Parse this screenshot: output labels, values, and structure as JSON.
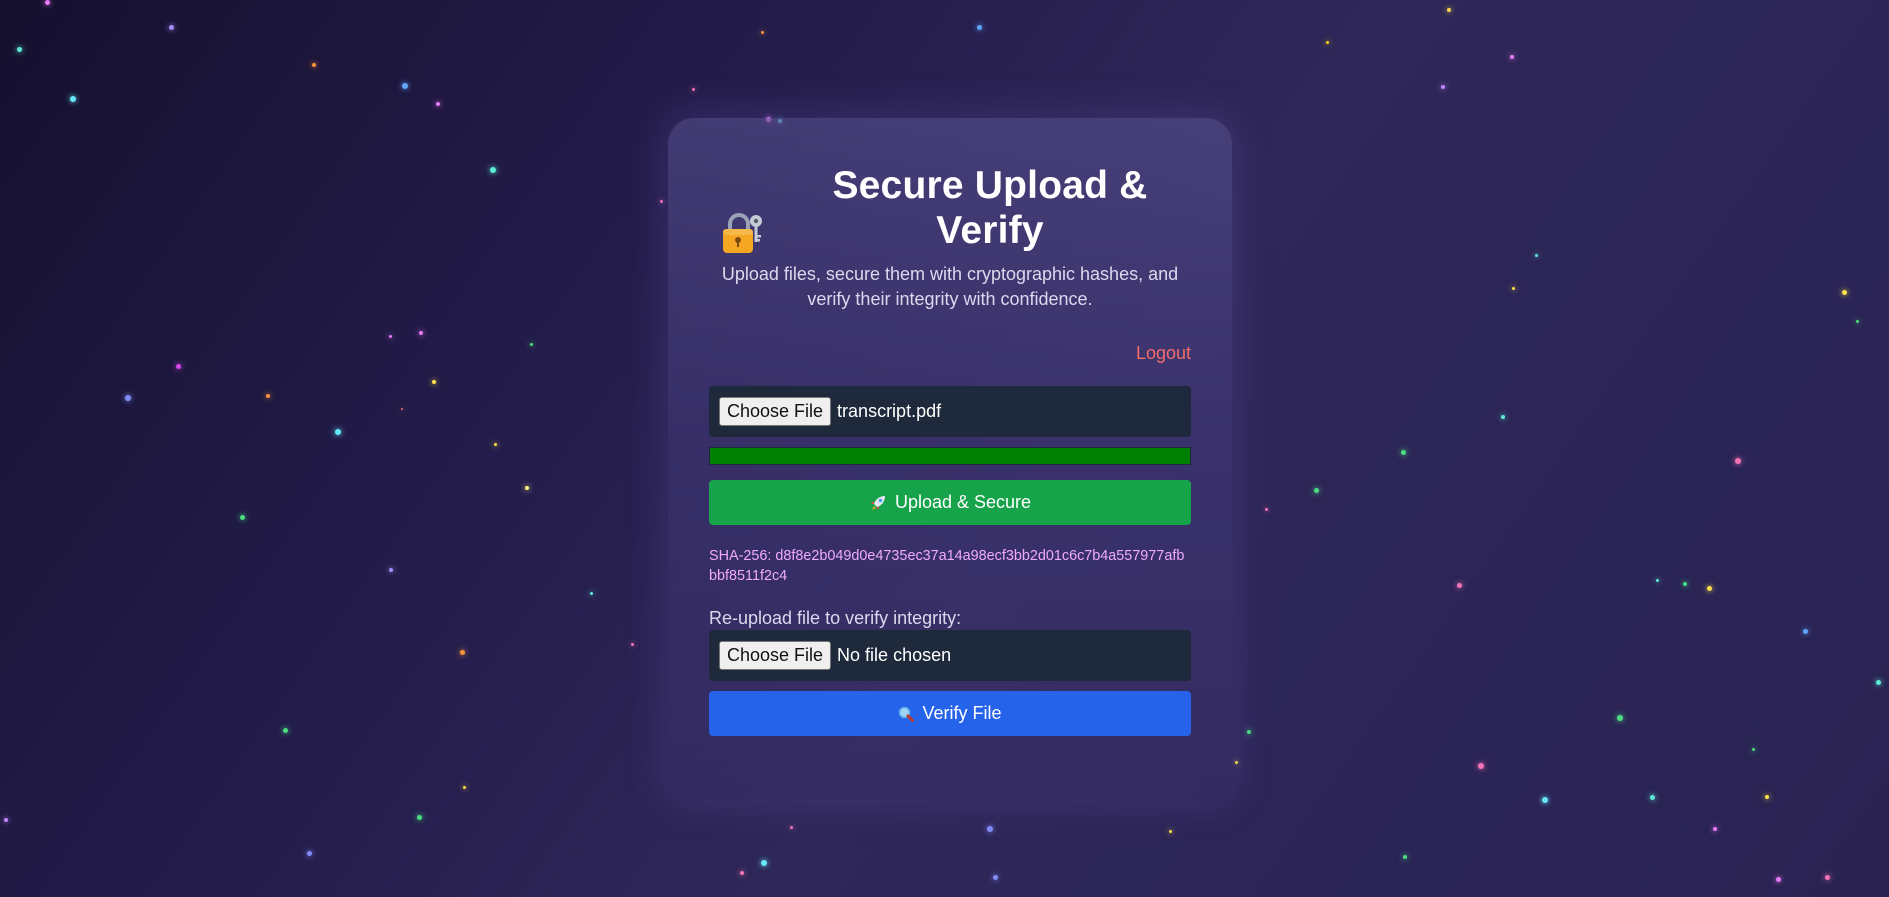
{
  "header": {
    "title": "Secure Upload & Verify",
    "subtitle": "Upload files, secure them with cryptographic hashes, and verify their integrity with confidence.",
    "icon": "lock-with-key-icon"
  },
  "nav": {
    "logout_label": "Logout"
  },
  "upload": {
    "choose_label": "Choose File",
    "file_name": "transcript.pdf",
    "progress": 1.0,
    "button_label": "Upload & Secure",
    "button_icon": "rocket-icon"
  },
  "hash": {
    "text": "SHA-256: d8f8e2b049d0e4735ec37a14a98ecf3bb2d01c6c7b4a557977afbbbf8511f2c4"
  },
  "verify": {
    "label": "Re-upload file to verify integrity:",
    "choose_label": "Choose File",
    "file_name": "No file chosen",
    "button_label": "Verify File",
    "button_icon": "magnifier-icon"
  },
  "colors": {
    "upload_button": "#16a34a",
    "verify_button": "#2563eb",
    "progress_fill": "#008000",
    "logout": "#f36b6b",
    "hash_text": "#f0abfc",
    "file_box": "#1e293b"
  }
}
